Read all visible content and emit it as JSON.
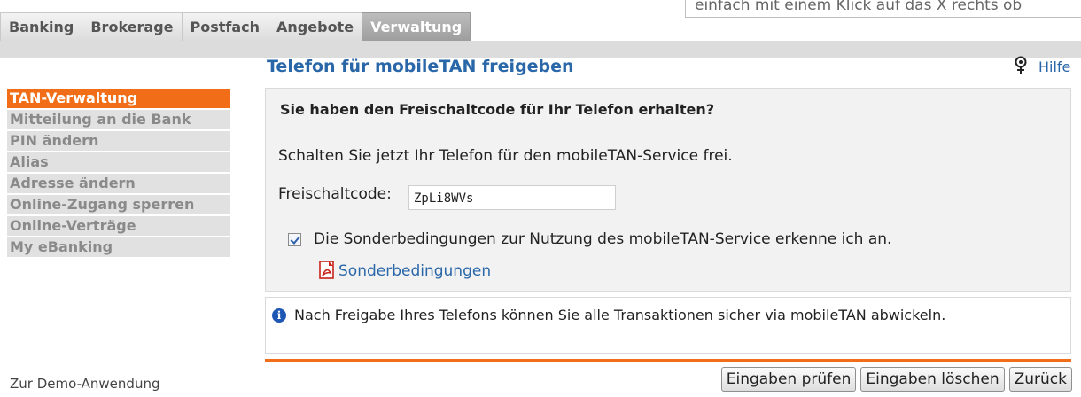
{
  "search_hint": "einfach mit einem Klick auf das X rechts ob",
  "tabs": [
    {
      "label": "Banking",
      "active": false
    },
    {
      "label": "Brokerage",
      "active": false
    },
    {
      "label": "Postfach",
      "active": false
    },
    {
      "label": "Angebote",
      "active": false
    },
    {
      "label": "Verwaltung",
      "active": true
    }
  ],
  "sidebar": {
    "items": [
      {
        "label": "TAN-Verwaltung",
        "active": true
      },
      {
        "label": "Mitteilung an die Bank",
        "active": false
      },
      {
        "label": "PIN ändern",
        "active": false
      },
      {
        "label": "Alias",
        "active": false
      },
      {
        "label": "Adresse ändern",
        "active": false
      },
      {
        "label": "Online-Zugang sperren",
        "active": false
      },
      {
        "label": "Online-Verträge",
        "active": false
      },
      {
        "label": "My eBanking",
        "active": false
      }
    ],
    "demo_link": "Zur Demo-Anwendung"
  },
  "main": {
    "title": "Telefon für mobileTAN freigeben",
    "help_label": "Hilfe",
    "form": {
      "heading": "Sie haben den Freischaltcode für Ihr Telefon erhalten?",
      "intro": "Schalten Sie jetzt Ihr Telefon für den mobileTAN-Service frei.",
      "code_label": "Freischaltcode:",
      "code_value": "ZpLi8WVs",
      "accept_label": "Die Sonderbedingungen zur Nutzung des mobileTAN-Service erkenne ich an.",
      "accept_checked": true,
      "terms_link": "Sonderbedingungen"
    },
    "info": "Nach Freigabe Ihres Telefons können Sie alle Transaktionen sicher via mobileTAN abwickeln."
  },
  "buttons": {
    "check": "Eingaben prüfen",
    "clear": "Eingaben löschen",
    "back": "Zurück"
  },
  "colors": {
    "accent_orange": "#f26d17",
    "link_blue": "#2a67a8",
    "info_blue": "#1f57b4"
  },
  "icons": [
    "help-icon",
    "pdf-icon",
    "info-icon",
    "checkbox-checked"
  ]
}
